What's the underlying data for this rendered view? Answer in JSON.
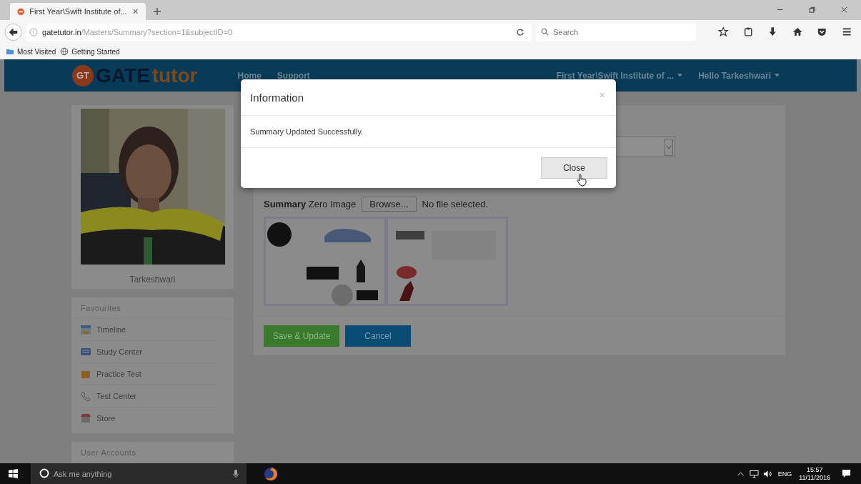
{
  "browser": {
    "tab": {
      "title": "First Year\\Swift Institute of...",
      "selected": true
    },
    "url": {
      "host": "gatetutor.in",
      "path": "/Masters/Summary?section=1&subjectID=0"
    },
    "search": {
      "placeholder": "Search"
    },
    "bookmarks": [
      {
        "label": "Most Visited",
        "kind": "folder"
      },
      {
        "label": "Getting Started",
        "kind": "globe"
      }
    ]
  },
  "site": {
    "logo": {
      "badge": "GT",
      "main": "GATE",
      "accent": "tutor"
    },
    "nav": [
      "Home",
      "Support"
    ],
    "menus": [
      "First Year\\Swift Institute of ...",
      "Hello Tarkeshwari"
    ]
  },
  "profile": {
    "name": "Tarkeshwari"
  },
  "favourites": {
    "title": "Favourites",
    "items": [
      {
        "label": "Timeline",
        "kind": "calendar"
      },
      {
        "label": "Study Center",
        "kind": "book"
      },
      {
        "label": "Practice Test",
        "kind": "folder"
      },
      {
        "label": "Test Center",
        "kind": "phone"
      },
      {
        "label": "Store",
        "kind": "store"
      }
    ]
  },
  "user_accounts": {
    "title": "User Accounts"
  },
  "form": {
    "label": "Summary",
    "sublabel": "Zero Image",
    "browse": "Browse...",
    "file_status": "No file selected.",
    "buttons": [
      {
        "label": "Save & Update",
        "kind": "primary"
      },
      {
        "label": "Cancel",
        "kind": "secondary"
      }
    ]
  },
  "modal": {
    "title": "Information",
    "close": "×",
    "message": "Summary Updated Successfully.",
    "button": "Close"
  },
  "taskbar": {
    "search": {
      "placeholder": "Ask me anything"
    },
    "language": "ENG",
    "time": "15:57",
    "date": "11/11/2016"
  }
}
